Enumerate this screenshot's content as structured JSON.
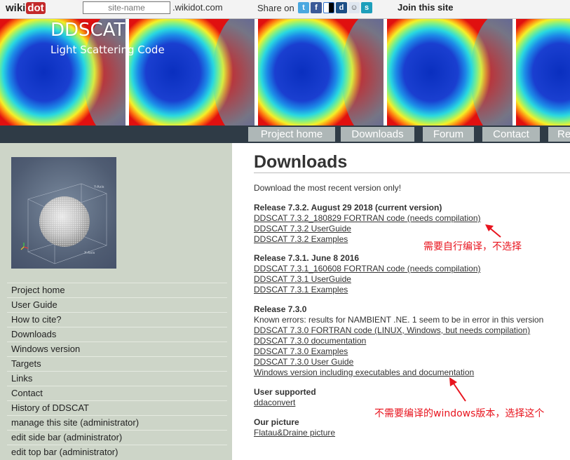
{
  "wikidot_bar": {
    "logo_main": "wiki",
    "logo_accent": "dot",
    "site_name_placeholder": "site-name",
    "domain_suffix": ".wikidot.com",
    "share_label": "Share on",
    "share_icons": [
      "twitter-icon",
      "facebook-icon",
      "delicious-icon",
      "digg-icon",
      "reddit-icon",
      "stumbleupon-icon"
    ],
    "join_label": "Join this site"
  },
  "header": {
    "title": "DDSCAT",
    "subtitle": "Light Scattering Code"
  },
  "top_nav": {
    "items": [
      "Project home",
      "Downloads",
      "Forum",
      "Contact",
      "Re"
    ]
  },
  "sidebar": {
    "items": [
      "Project home",
      "User Guide",
      "How to cite?",
      "Downloads",
      "Windows version",
      "Targets",
      "Links",
      "Contact",
      "History of DDSCAT",
      "manage this site (administrator)",
      "edit side bar (administrator)",
      "edit top bar (administrator)"
    ]
  },
  "main": {
    "title": "Downloads",
    "intro": "Download the most recent version only!",
    "release_732": {
      "heading": "Release 7.3.2. August 29 2018 (current version)",
      "links": [
        "DDSCAT 7.3.2_180829 FORTRAN code (needs compilation)",
        "DDSCAT 7.3.2 UserGuide",
        "DDSCAT 7.3.2 Examples"
      ]
    },
    "release_731": {
      "heading": "Release 7.3.1. June 8 2016",
      "links": [
        "DDSCAT 7.3.1_160608 FORTRAN code (needs compilation)",
        "DDSCAT 7.3.1 UserGuide",
        "DDSCAT 7.3.1 Examples"
      ]
    },
    "release_730": {
      "heading": "Release 7.3.0",
      "known_errors": "Known errors: results for NAMBIENT .NE. 1 seem to be in error in this version",
      "links": [
        "DDSCAT 7.3.0 FORTRAN code (LINUX, Windows, but needs compilation)",
        "DDSCAT 7.3.0 documentation",
        "DDSCAT 7.3.0 Examples",
        "DDSCAT 7.3.0 User Guide",
        "Windows version including executables and documentation"
      ]
    },
    "user_supported": {
      "heading": "User supported",
      "link": "ddaconvert"
    },
    "our_picture": {
      "heading": "Our picture",
      "link": "Flatau&Draine picture"
    }
  },
  "annotations": {
    "note_1": "需要自行编译，不选择",
    "note_2": "不需要编译的windows版本，选择这个",
    "color": "#e8141e"
  }
}
